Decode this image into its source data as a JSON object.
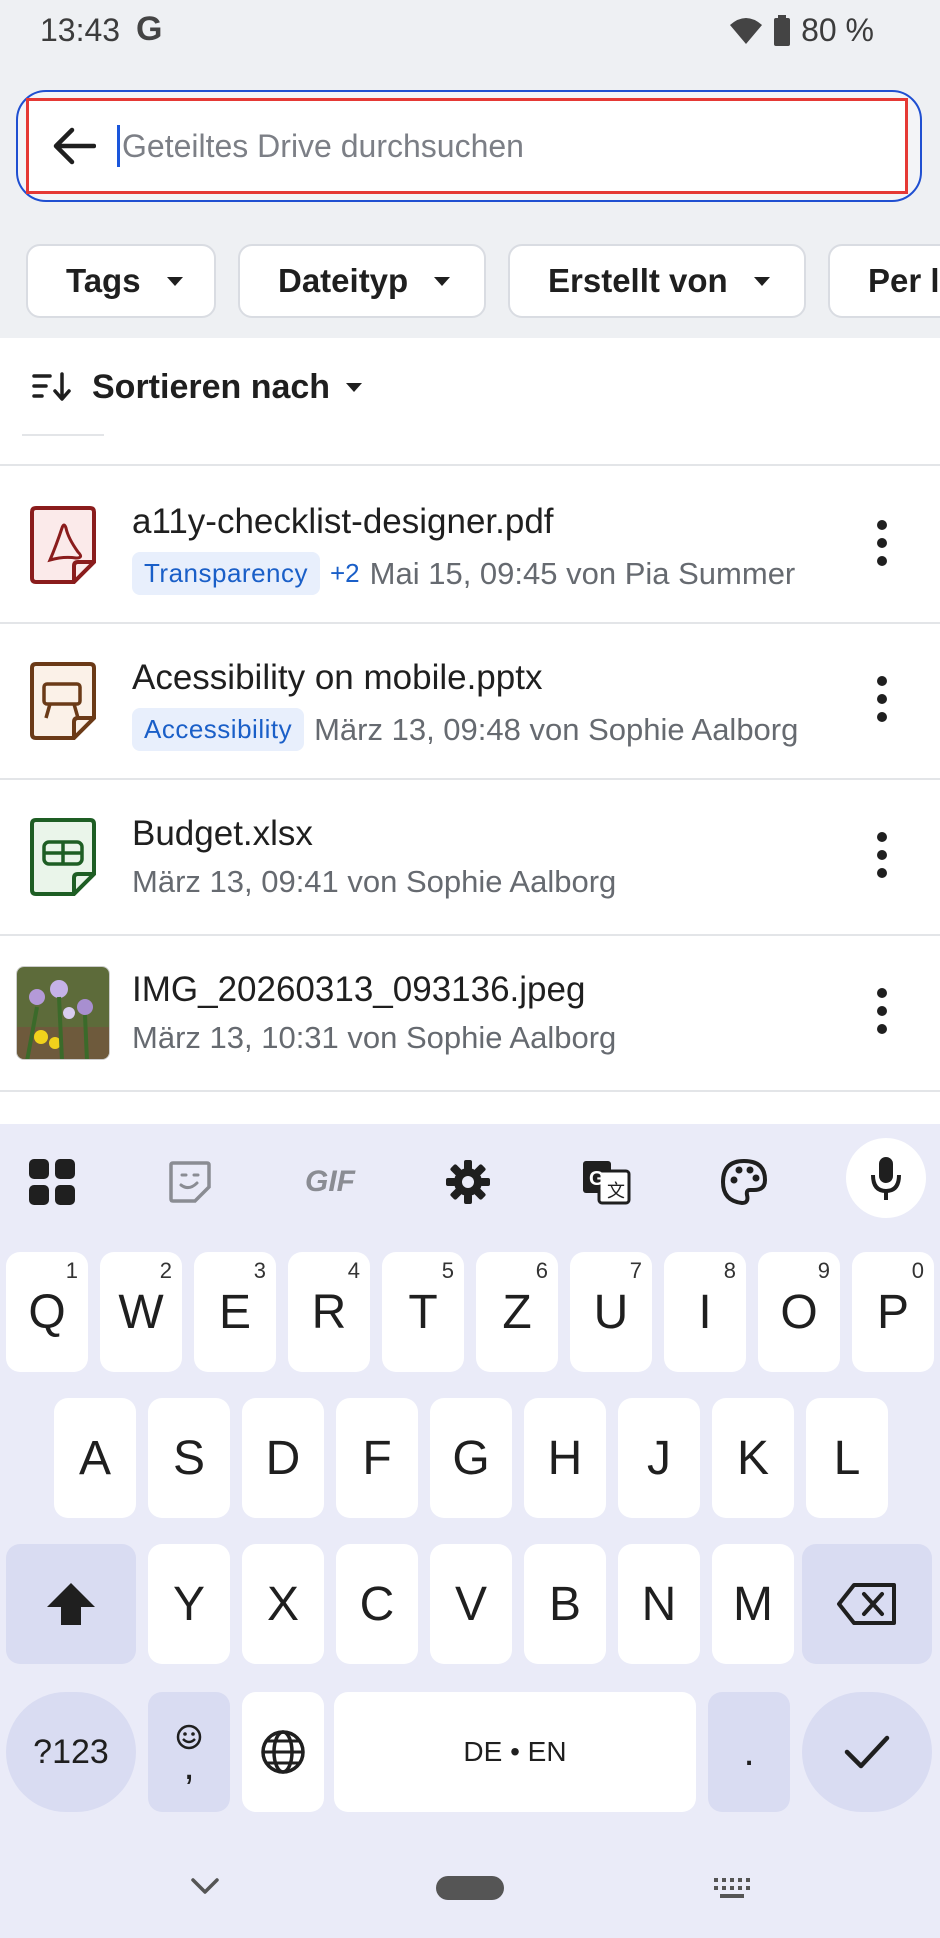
{
  "status": {
    "time": "13:43",
    "g_logo": "G",
    "battery": "80 %"
  },
  "search": {
    "placeholder": "Geteiltes Drive durchsuchen"
  },
  "chips": [
    "Tags",
    "Dateityp",
    "Erstellt von",
    "Per l"
  ],
  "sort": {
    "label": "Sortieren nach"
  },
  "files": [
    {
      "name": "a11y-checklist-designer.pdf",
      "tag": "Transparency",
      "extra": "+2",
      "meta": "Mai 15, 09:45 von Pia Summer",
      "icon": "pdf-icon"
    },
    {
      "name": "Acessibility on mobile.pptx",
      "tag": "Accessibility",
      "meta": "März 13, 09:48 von Sophie Aalborg",
      "icon": "slides-icon"
    },
    {
      "name": "Budget.xlsx",
      "meta": "März 13, 09:41 von Sophie Aalborg",
      "icon": "spreadsheet-icon"
    },
    {
      "name": "IMG_20260313_093136.jpeg",
      "meta": "März 13, 10:31 von Sophie Aalborg",
      "icon": "image-thumbnail"
    }
  ],
  "keyboard": {
    "toolbar": [
      "apps-icon",
      "sticker-icon",
      "GIF",
      "settings-icon",
      "translate-icon",
      "palette-icon",
      "mic-icon"
    ],
    "row1": [
      [
        "Q",
        "1"
      ],
      [
        "W",
        "2"
      ],
      [
        "E",
        "3"
      ],
      [
        "R",
        "4"
      ],
      [
        "T",
        "5"
      ],
      [
        "Z",
        "6"
      ],
      [
        "U",
        "7"
      ],
      [
        "I",
        "8"
      ],
      [
        "O",
        "9"
      ],
      [
        "P",
        "0"
      ]
    ],
    "row2": [
      "A",
      "S",
      "D",
      "F",
      "G",
      "H",
      "J",
      "K",
      "L"
    ],
    "row3": [
      "Y",
      "X",
      "C",
      "V",
      "B",
      "N",
      "M"
    ],
    "symbols": "?123",
    "emoji_comma": ",",
    "space": "DE • EN",
    "period": "."
  },
  "colors": {
    "accent": "#1a56db",
    "highlight": "#e53935",
    "tag_bg": "#e8effc",
    "tag_text": "#1a5fc8"
  }
}
